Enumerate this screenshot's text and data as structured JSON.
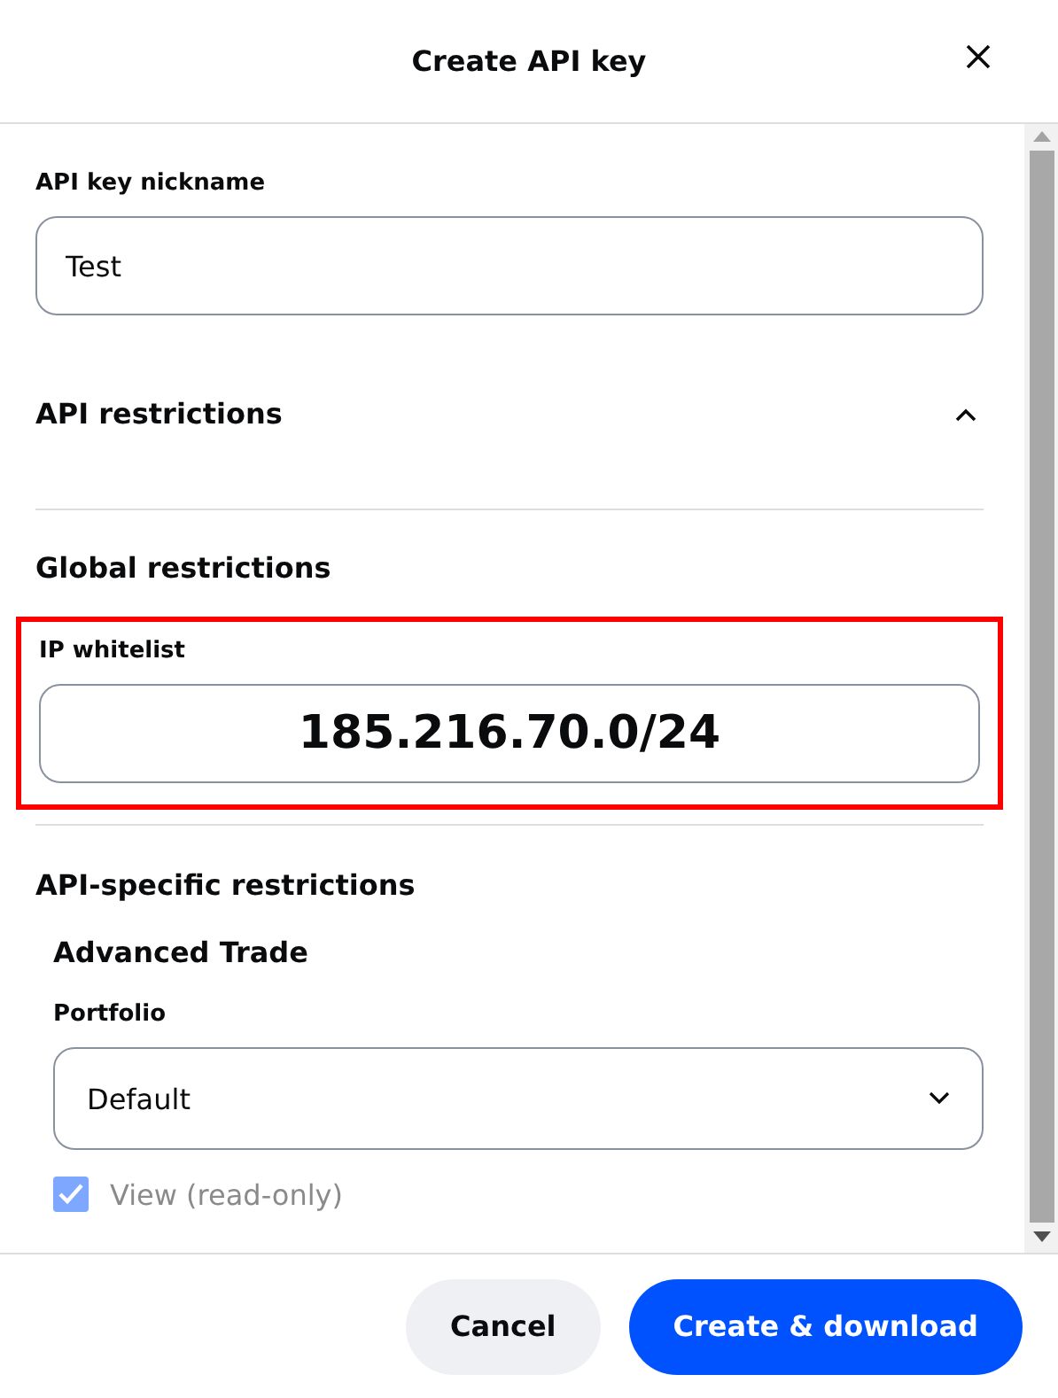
{
  "dialog": {
    "title": "Create API key"
  },
  "nickname": {
    "label": "API key nickname",
    "value": "Test"
  },
  "restrictions": {
    "title": "API restrictions",
    "expanded": true
  },
  "global": {
    "title": "Global restrictions"
  },
  "ip_whitelist": {
    "label": "IP whitelist",
    "value": "185.216.70.0/24",
    "highlighted": true
  },
  "api_specific": {
    "title": "API-specific restrictions",
    "product": "Advanced Trade"
  },
  "portfolio": {
    "label": "Portfolio",
    "value": "Default"
  },
  "permissions": [
    {
      "label": "View (read-only)",
      "checked": true,
      "disabled": true
    }
  ],
  "buttons": [
    {
      "label": "Cancel",
      "kind": "secondary"
    },
    {
      "label": "Create & download",
      "kind": "primary"
    }
  ]
}
